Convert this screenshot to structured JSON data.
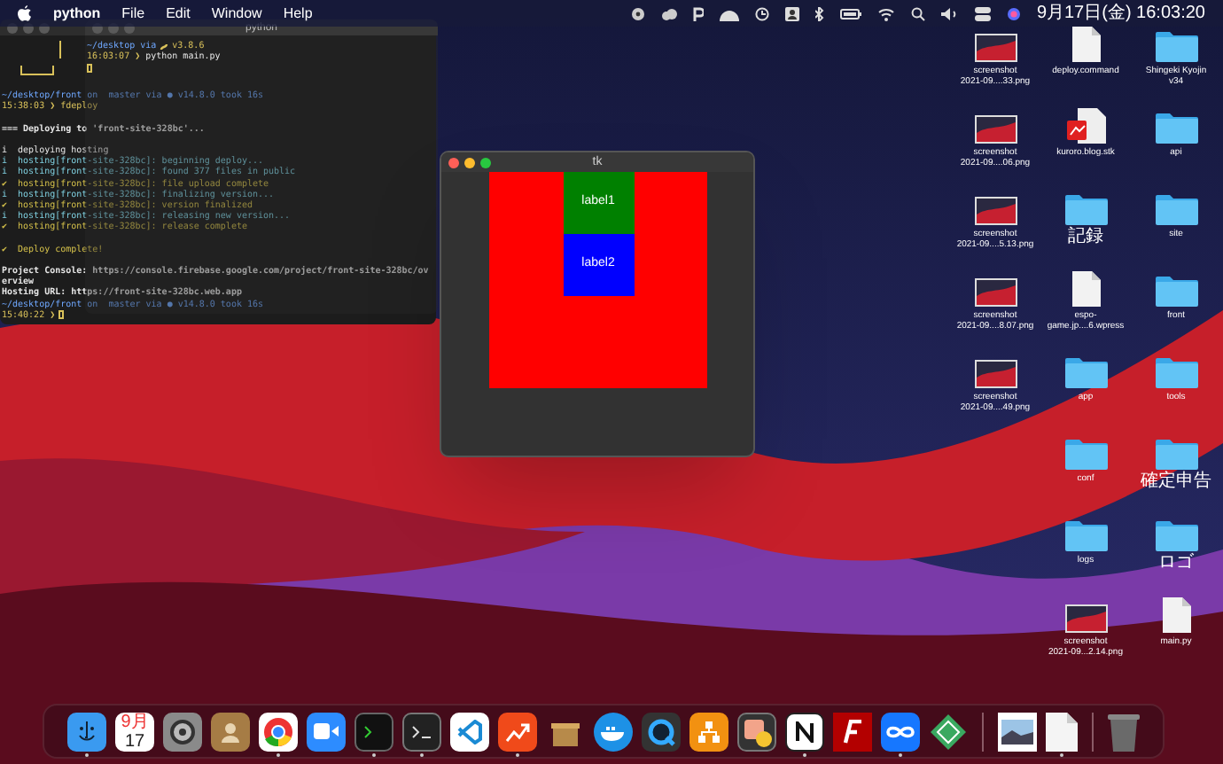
{
  "menu_bar": {
    "app": "python",
    "menus": [
      "File",
      "Edit",
      "Window",
      "Help"
    ],
    "clock": "9月17日(金) 16:03:20"
  },
  "back_terminal": {
    "lines": [
      {
        "kind": "path",
        "text": "~/desktop/front on  master via ● v14.8.0 took 16s"
      },
      {
        "kind": "time",
        "text": "15:38:03 ❯ fdeploy"
      },
      {
        "kind": "blank"
      },
      {
        "kind": "heading",
        "text": "=== Deploying to 'front-site-328bc'..."
      },
      {
        "kind": "blank"
      },
      {
        "kind": "plain",
        "text": "i  deploying hosting"
      },
      {
        "kind": "info",
        "text": "i  hosting[front-site-328bc]: beginning deploy..."
      },
      {
        "kind": "info",
        "text": "i  hosting[front-site-328bc]: found 377 files in public"
      },
      {
        "kind": "success",
        "text": "✔  hosting[front-site-328bc]: file upload complete"
      },
      {
        "kind": "info",
        "text": "i  hosting[front-site-328bc]: finalizing version..."
      },
      {
        "kind": "success",
        "text": "✔  hosting[front-site-328bc]: version finalized"
      },
      {
        "kind": "info",
        "text": "i  hosting[front-site-328bc]: releasing new version..."
      },
      {
        "kind": "success",
        "text": "✔  hosting[front-site-328bc]: release complete"
      },
      {
        "kind": "blank"
      },
      {
        "kind": "success",
        "text": "✔  Deploy complete!"
      },
      {
        "kind": "blank"
      },
      {
        "kind": "heading",
        "text": "Project Console: https://console.firebase.google.com/project/front-site-328bc/ov"
      },
      {
        "kind": "heading",
        "text": "erview"
      },
      {
        "kind": "heading",
        "text": "Hosting URL: https://front-site-328bc.web.app"
      },
      {
        "kind": "path",
        "text": "~/desktop/front on  master via ● v14.8.0 took 16s"
      },
      {
        "kind": "time",
        "text": "15:40:22 ❯"
      }
    ]
  },
  "front_terminal": {
    "title": "python",
    "directory": "~/desktop via",
    "python_version": "v3.8.6",
    "time": "16:03:07 ❯",
    "command": "python main.py"
  },
  "tk_window": {
    "title": "tk",
    "labels": [
      {
        "text": "label1",
        "color": "#008000"
      },
      {
        "text": "label2",
        "color": "#0000ff"
      }
    ]
  },
  "desktop": {
    "columns": [
      [
        {
          "kind": "screenshot",
          "label": [
            "screenshot",
            "2021-09....33.png"
          ]
        },
        {
          "kind": "screenshot",
          "label": [
            "screenshot",
            "2021-09....06.png"
          ]
        },
        {
          "kind": "screenshot",
          "label": [
            "screenshot",
            "2021-09....5.13.png"
          ]
        },
        {
          "kind": "screenshot",
          "label": [
            "screenshot",
            "2021-09....8.07.png"
          ]
        },
        {
          "kind": "screenshot",
          "label": [
            "screenshot",
            "2021-09....49.png"
          ]
        }
      ],
      [
        {
          "kind": "document",
          "label": [
            "deploy.command"
          ]
        },
        {
          "kind": "stack",
          "label": [
            "kuroro.blog.stk"
          ]
        },
        {
          "kind": "folder",
          "label": [
            "記録"
          ]
        },
        {
          "kind": "document",
          "label": [
            "espo-",
            "game.jp....6.wpress"
          ]
        },
        {
          "kind": "folder",
          "label": [
            "app"
          ]
        },
        {
          "kind": "folder",
          "label": [
            "conf"
          ]
        },
        {
          "kind": "folder",
          "label": [
            "logs"
          ]
        },
        {
          "kind": "screenshot",
          "label": [
            "screenshot",
            "2021-09...2.14.png"
          ]
        }
      ],
      [
        {
          "kind": "folder",
          "label": [
            "Shingeki Kyojin",
            "v34"
          ]
        },
        {
          "kind": "folder",
          "label": [
            "api"
          ]
        },
        {
          "kind": "folder",
          "label": [
            "site"
          ]
        },
        {
          "kind": "folder",
          "label": [
            "front"
          ]
        },
        {
          "kind": "folder",
          "label": [
            "tools"
          ]
        },
        {
          "kind": "folder",
          "label": [
            "確定申告"
          ]
        },
        {
          "kind": "folder",
          "label": [
            "ロゴ"
          ]
        },
        {
          "kind": "document",
          "label": [
            "main.py"
          ]
        }
      ]
    ]
  },
  "dock": {
    "calendar": {
      "month": "9月",
      "day": "17"
    },
    "items": [
      {
        "running": true
      },
      {
        "running": false
      },
      {
        "running": false
      },
      {
        "running": false
      },
      {
        "running": true
      },
      {
        "running": false
      },
      {
        "running": true
      },
      {
        "running": true
      },
      {
        "running": false
      },
      {
        "running": true
      },
      {
        "running": false
      },
      {
        "running": false
      },
      {
        "running": false
      },
      {
        "running": false
      },
      {
        "running": false
      },
      {
        "running": true
      },
      {
        "running": false
      },
      {
        "running": true
      },
      {
        "running": false
      },
      {
        "running": false
      },
      {
        "running": true
      },
      {
        "running": false
      }
    ]
  }
}
